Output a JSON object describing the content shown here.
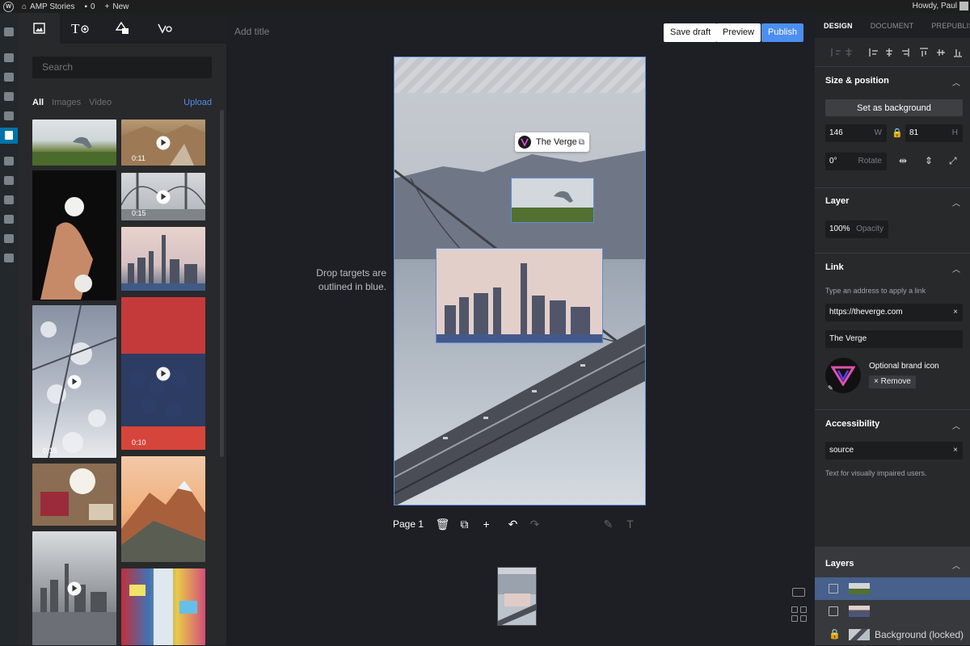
{
  "admin_bar": {
    "site_name": "AMP Stories",
    "comments_count": "0",
    "new_label": "New",
    "howdy": "Howdy, Paul"
  },
  "library": {
    "tabs": [
      "media",
      "text",
      "shapes",
      "links"
    ],
    "search_placeholder": "Search",
    "filters": {
      "all": "All",
      "images": "Images",
      "video": "Video",
      "upload": "Upload"
    },
    "durations": {
      "canyon": "0:11",
      "bridge": "0:15",
      "blossom": "0:15",
      "berries": "0:10"
    }
  },
  "workspace": {
    "add_title": "Add title",
    "save_draft": "Save draft",
    "preview": "Preview",
    "publish": "Publish",
    "hint": "Drop targets are outlined in blue.",
    "link_chip": "The Verge",
    "page_label": "Page 1"
  },
  "inspector": {
    "tabs": {
      "design": "DESIGN",
      "document": "DOCUMENT",
      "prepublish": "PREPUBLISH"
    },
    "size_position": {
      "title": "Size & position",
      "set_background": "Set as background",
      "width": "146",
      "width_suffix": "W",
      "height": "81",
      "height_suffix": "H",
      "rotate": "0°",
      "rotate_suffix": "Rotate"
    },
    "layer": {
      "title": "Layer",
      "opacity": "100%",
      "opacity_suffix": "Opacity"
    },
    "link": {
      "title": "Link",
      "help": "Type an address to apply a link",
      "url": "https://theverge.com",
      "description": "The Verge",
      "brand_icon_label": "Optional brand icon",
      "remove": "Remove"
    },
    "accessibility": {
      "title": "Accessibility",
      "alt_text": "source",
      "help": "Text for visually impaired users."
    },
    "layers": {
      "title": "Layers",
      "background_label": "Background (locked)"
    }
  }
}
